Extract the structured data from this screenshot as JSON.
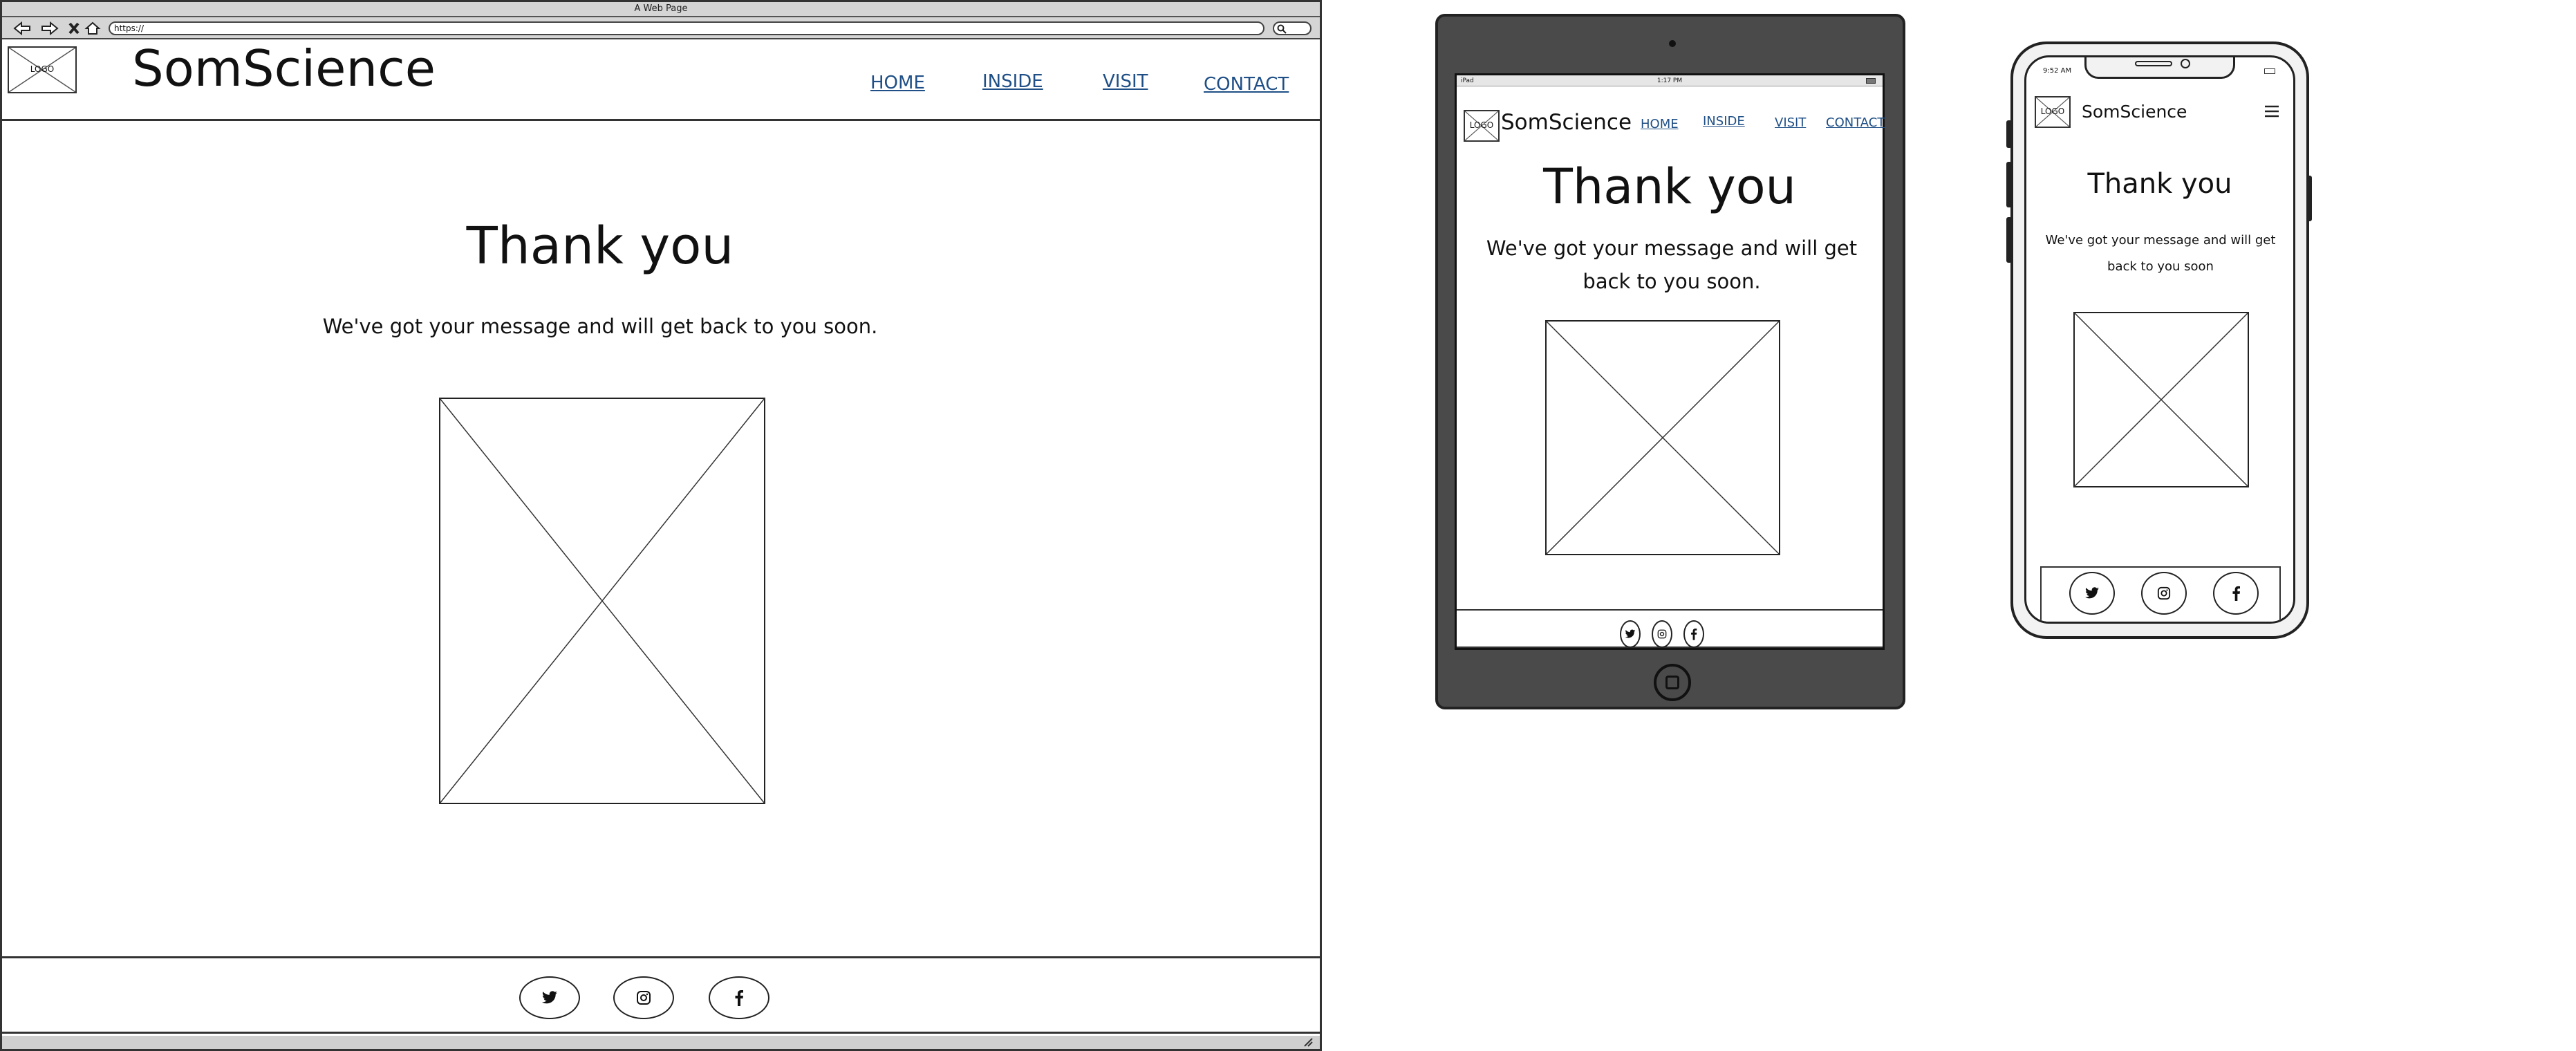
{
  "desktop": {
    "window_title": "A Web Page",
    "url": "https://",
    "logo_text": "LOGO",
    "brand": "SomScience",
    "nav": [
      "HOME",
      "INSIDE",
      "VISIT",
      "CONTACT"
    ],
    "heading": "Thank you",
    "message": "We've got your message and will get back to you soon.",
    "social_icons": [
      "twitter-icon",
      "instagram-icon",
      "facebook-icon"
    ]
  },
  "tablet": {
    "status_left": "iPad",
    "status_time": "1:17 PM",
    "logo_text": "LOGO",
    "brand": "SomScience",
    "nav": [
      "HOME",
      "INSIDE",
      "VISIT",
      "CONTACT"
    ],
    "heading": "Thank you",
    "message": "We've got your message and will get back to you soon.",
    "social_icons": [
      "twitter-icon",
      "instagram-icon",
      "facebook-icon"
    ]
  },
  "phone": {
    "status_time": "9:52 AM",
    "logo_text": "LOGO",
    "brand": "SomScience",
    "heading": "Thank you",
    "message": "We've got your message and will get back to you soon",
    "social_icons": [
      "twitter-icon",
      "instagram-icon",
      "facebook-icon"
    ]
  }
}
